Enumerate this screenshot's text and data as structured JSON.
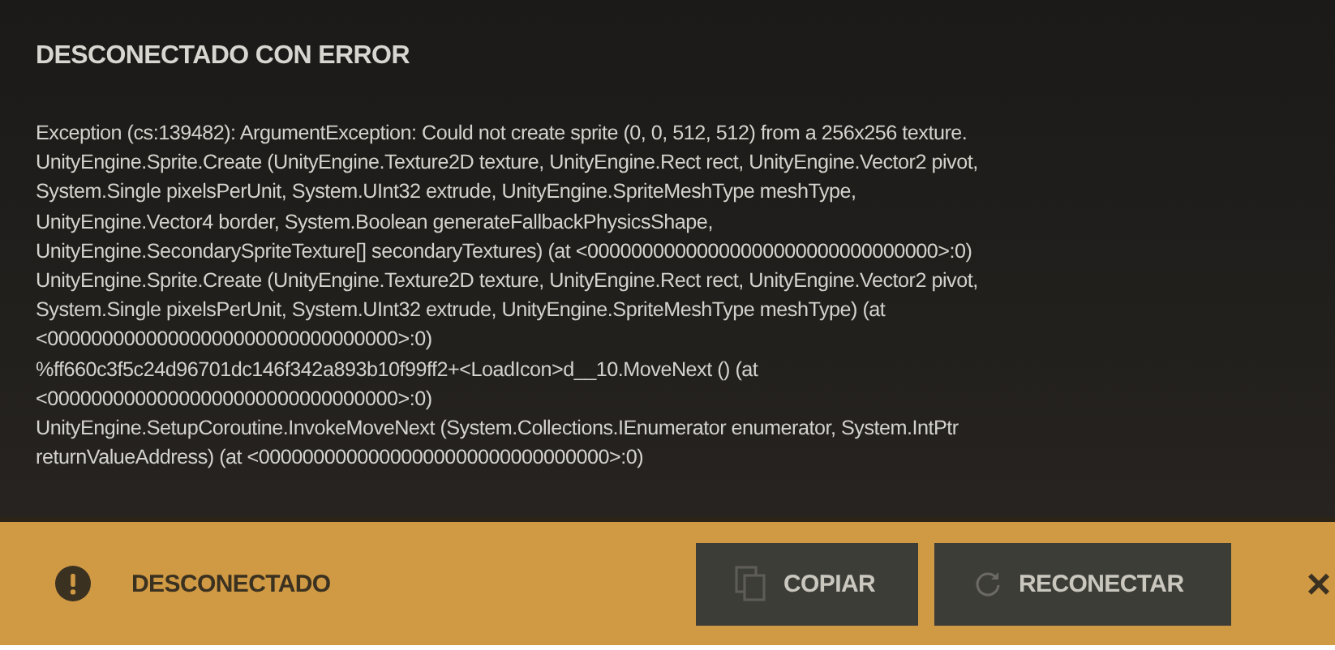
{
  "dialog": {
    "title": "DESCONECTADO CON ERROR",
    "message_lines": [
      "Exception (cs:139482): ArgumentException: Could not create sprite (0, 0, 512, 512) from a 256x256 texture.",
      "UnityEngine.Sprite.Create (UnityEngine.Texture2D texture, UnityEngine.Rect rect, UnityEngine.Vector2 pivot,",
      "System.Single pixelsPerUnit, System.UInt32 extrude, UnityEngine.SpriteMeshType meshType,",
      "UnityEngine.Vector4 border, System.Boolean generateFallbackPhysicsShape,",
      "UnityEngine.SecondarySpriteTexture[] secondaryTextures) (at <00000000000000000000000000000000>:0)",
      "UnityEngine.Sprite.Create (UnityEngine.Texture2D texture, UnityEngine.Rect rect, UnityEngine.Vector2 pivot,",
      "System.Single pixelsPerUnit, System.UInt32 extrude, UnityEngine.SpriteMeshType meshType) (at",
      "<00000000000000000000000000000000>:0)",
      "%ff660c3f5c24d96701dc146f342a893b10f99ff2+<LoadIcon>d__10.MoveNext () (at",
      "<00000000000000000000000000000000>:0)",
      "UnityEngine.SetupCoroutine.InvokeMoveNext (System.Collections.IEnumerator enumerator, System.IntPtr",
      "returnValueAddress) (at <00000000000000000000000000000000>:0)"
    ]
  },
  "status_bar": {
    "status": "DESCONECTADO",
    "buttons": [
      {
        "kind": "copy",
        "label": "COPIAR"
      },
      {
        "kind": "reconnect",
        "label": "RECONECTAR"
      }
    ],
    "close": "×"
  }
}
